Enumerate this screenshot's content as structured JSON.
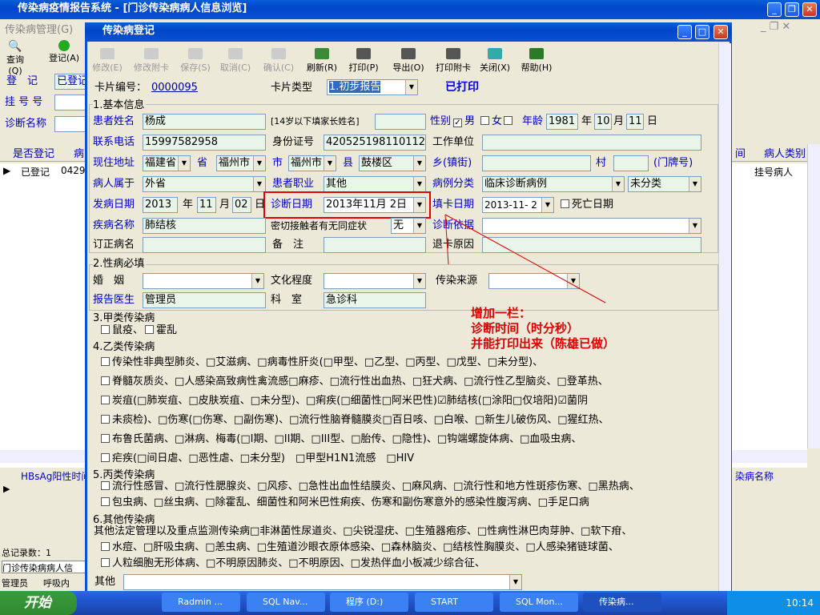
{
  "main_title": "传染病疫情报告系统 - [门诊传染病病人信息浏览]",
  "menu_item": "传染病管理(G)",
  "left_tools": [
    "查询(Q)",
    "登记(A)"
  ],
  "left_labels": [
    "登　记",
    "挂 号 号",
    "诊断名称"
  ],
  "left_reg_value": "已登记",
  "grid": {
    "col_registered": "是否登记",
    "col_patient": "病",
    "row_status": "已登记",
    "row_num": "0429",
    "right_col1": "间",
    "right_col2": "病人类别",
    "right_cell": "挂号病人"
  },
  "lower_grid": {
    "col_left": "HBsAg阳性时间",
    "col_right": "染病名称"
  },
  "status": {
    "count": "总记录数：1",
    "tab": "门诊传染病病人信",
    "admin": "管理员",
    "call": "呼吸内"
  },
  "dialog": {
    "title": "传染病登记",
    "toolbar": [
      {
        "label": "修改(E)",
        "enabled": false
      },
      {
        "label": "修改附卡",
        "enabled": false
      },
      {
        "label": "保存(S)",
        "enabled": false
      },
      {
        "label": "取消(C)",
        "enabled": false
      },
      {
        "label": "确认(C)",
        "enabled": false
      },
      {
        "label": "刷新(R)",
        "enabled": true
      },
      {
        "label": "打印(P)",
        "enabled": true
      },
      {
        "label": "导出(O)",
        "enabled": true
      },
      {
        "label": "打印附卡",
        "enabled": true
      },
      {
        "label": "关闭(X)",
        "enabled": true
      },
      {
        "label": "帮助(H)",
        "enabled": true
      }
    ],
    "card_no_label": "卡片编号：",
    "card_no": "0000095",
    "card_type_label": "卡片类型",
    "card_type": "1.初步报告",
    "printed": "已打印",
    "sec1": "1.基本信息",
    "f": {
      "name_l": "患者姓名",
      "name": "杨成",
      "under14": "[14岁以下填家长姓名]",
      "sex_l": "性别",
      "male": "男",
      "female": "女",
      "age_l": "年龄",
      "year": "1981",
      "year_u": "年",
      "month": "10",
      "month_u": "月",
      "day": "11",
      "day_u": "日",
      "phone_l": "联系电话",
      "phone": "15997582958",
      "id_l": "身份证号",
      "id": "420525198110112",
      "work_l": "工作单位",
      "addr_l": "现住地址",
      "prov": "福建省",
      "prov_u": "省",
      "city": "福州市",
      "city_u": "市",
      "city2": "福州市",
      "county_u": "县",
      "county": "鼓楼区",
      "town_l": "乡(镇街)",
      "village_l": "村",
      "door_l": "(门牌号)",
      "belong_l": "病人属于",
      "belong": "外省",
      "job_l": "患者职业",
      "job": "其他",
      "cls_l": "病例分类",
      "cls": "临床诊断病例",
      "cls2": "未分类",
      "onset_l": "发病日期",
      "onset_y": "2013",
      "onset_yu": "年",
      "onset_m": "11",
      "onset_mu": "月",
      "onset_d": "02",
      "onset_du": "日",
      "diag_l": "诊断日期",
      "diag": "2013年11月 2日",
      "fill_l": "填卡日期",
      "fill": "2013-11- 2",
      "death_l": "死亡日期",
      "dis_l": "疾病名称",
      "dis": "肺结核",
      "contact_l": "密切接触者有无同症状",
      "contact": "无",
      "basis_l": "诊断依据",
      "rev_l": "订正病名",
      "note_l": "备　注",
      "ret_l": "退卡原因"
    },
    "sec2": "2.性病必填",
    "f2": {
      "marry_l": "婚　姻",
      "edu_l": "文化程度",
      "src_l": "传染来源",
      "doc_l": "报告医生",
      "doc": "管理员",
      "dept_l": "科　室",
      "dept": "急诊科"
    },
    "annotation": [
      "增加一栏：",
      "诊断时间（时分秒）",
      "并能打印出来（陈雄已做）"
    ],
    "sec3": "3.甲类传染病",
    "a_list": [
      "鼠疫、",
      "霍乱"
    ],
    "sec4": "4.乙类传染病",
    "b_lines": [
      "传染性非典型肺炎、□艾滋病、□病毒性肝炎(□甲型、□乙型、□丙型、□戊型、□未分型)、",
      "脊髓灰质炎、□人感染高致病性禽流感□麻疹、□流行性出血热、□狂犬病、□流行性乙型脑炎、□登革热、",
      "炭疽(□肺炭疽、□皮肤炭疽、□未分型)、□痢疾(□细菌性□阿米巴性)☑肺结核(□涂阳□仅培阳)☑菌阴",
      "未痰检)、□伤寒(□伤寒、□副伤寒)、□流行性脑脊髓膜炎□百日咳、□白喉、□新生儿破伤风、□猩红热、",
      "布鲁氏菌病、□淋病、梅毒(□I期、□II期、□III型、□胎传、□隐性)、□钩端螺旋体病、□血吸虫病、",
      "疟疾(□间日虐、□恶性虐、□未分型)　□甲型H1N1流感　□HIV"
    ],
    "sec5": "5.丙类传染病",
    "c_lines": [
      "流行性感冒、□流行性腮腺炎、□风疹、□急性出血性结膜炎、□麻风病、□流行性和地方性斑疹伤寒、□黑热病、",
      "包虫病、□丝虫病、□除霍乱、细菌性和阿米巴性痢疾、伤寒和副伤寒意外的感染性腹泻病、□手足口病"
    ],
    "sec6": "6.其他传染病",
    "o_lines": [
      "其他法定管理以及重点监测传染病□非淋菌性尿道炎、□尖锐湿疣、□生殖器疱疹、□性病性淋巴肉芽肿、□软下疳、",
      "水痘、□肝吸虫病、□恙虫病、□生殖道沙眼衣原体感染、□森林脑炎、□结核性胸膜炎、□人感染猪链球菌、",
      "人粒细胞无形体病、□不明原因肺炎、□不明原因、□发热伴血小板减少综合征、"
    ],
    "other_l": "其他"
  },
  "taskbar": {
    "start": "开始",
    "items": [
      "Radmin ...",
      "SQL Nav...",
      "程序 (D:)",
      "START",
      "SQL Mon...",
      "传染病..."
    ],
    "time": "10:14"
  },
  "colors": {
    "title": "#0a52d4",
    "field": "#e9f5e9",
    "label_blue": "#0000c8",
    "annot": "#e00000"
  }
}
